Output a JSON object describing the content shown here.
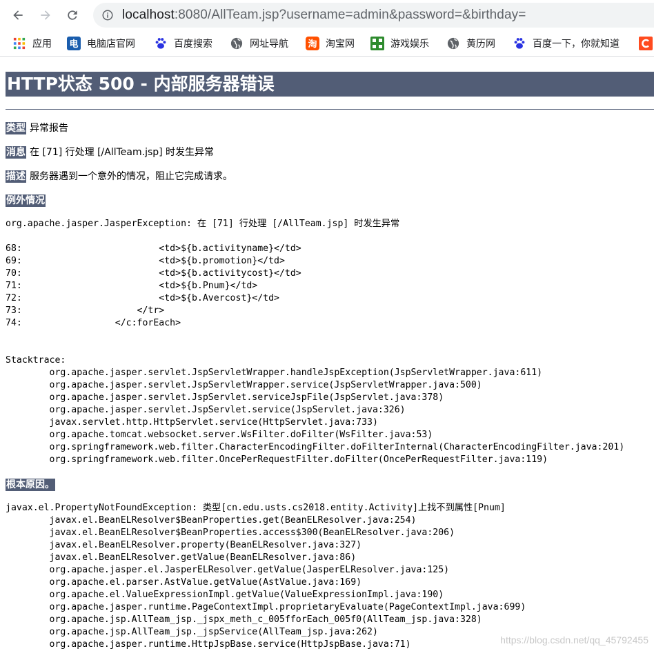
{
  "browser": {
    "url_host": "localhost",
    "url_rest": ":8080/AllTeam.jsp?username=admin&password=&birthday=",
    "bookmarks": [
      {
        "label": "应用",
        "icon": "apps-grid-icon"
      },
      {
        "label": "电脑店官网",
        "icon": "diannaodian-icon"
      },
      {
        "label": "百度搜索",
        "icon": "baidu-paw-icon"
      },
      {
        "label": "网址导航",
        "icon": "globe-icon"
      },
      {
        "label": "淘宝网",
        "icon": "taobao-icon"
      },
      {
        "label": "游戏娱乐",
        "icon": "game-icon"
      },
      {
        "label": "黄历网",
        "icon": "globe-icon"
      },
      {
        "label": "百度一下，你就知道",
        "icon": "baidu-paw-icon"
      }
    ]
  },
  "error": {
    "title": "HTTP状态 500 - 内部服务器错误",
    "type_label": "类型",
    "type_value": "异常报告",
    "message_label": "消息",
    "message_value": "在 [71] 行处理 [/AllTeam.jsp] 时发生异常",
    "description_label": "描述",
    "description_value": "服务器遇到一个意外的情况，阻止它完成请求。",
    "exception_label": "例外情况",
    "exception_lines": [
      "org.apache.jasper.JasperException: 在 [71] 行处理 [/AllTeam.jsp] 时发生异常",
      "",
      "68:                         <td>${b.activityname}</td>",
      "69:                         <td>${b.promotion}</td>",
      "70:                         <td>${b.activitycost}</td>",
      "71:                         <td>${b.Pnum}</td>",
      "72:                         <td>${b.Avercost}</td>",
      "73:                     </tr>",
      "74:                 </c:forEach>",
      "",
      "",
      "Stacktrace:",
      "        org.apache.jasper.servlet.JspServletWrapper.handleJspException(JspServletWrapper.java:611)",
      "        org.apache.jasper.servlet.JspServletWrapper.service(JspServletWrapper.java:500)",
      "        org.apache.jasper.servlet.JspServlet.serviceJspFile(JspServlet.java:378)",
      "        org.apache.jasper.servlet.JspServlet.service(JspServlet.java:326)",
      "        javax.servlet.http.HttpServlet.service(HttpServlet.java:733)",
      "        org.apache.tomcat.websocket.server.WsFilter.doFilter(WsFilter.java:53)",
      "        org.springframework.web.filter.CharacterEncodingFilter.doFilterInternal(CharacterEncodingFilter.java:201)",
      "        org.springframework.web.filter.OncePerRequestFilter.doFilter(OncePerRequestFilter.java:119)"
    ],
    "root_cause_label": "根本原因。",
    "root_cause_lines": [
      "javax.el.PropertyNotFoundException: 类型[cn.edu.usts.cs2018.entity.Activity]上找不到属性[Pnum]",
      "        javax.el.BeanELResolver$BeanProperties.get(BeanELResolver.java:254)",
      "        javax.el.BeanELResolver$BeanProperties.access$300(BeanELResolver.java:206)",
      "        javax.el.BeanELResolver.property(BeanELResolver.java:327)",
      "        javax.el.BeanELResolver.getValue(BeanELResolver.java:86)",
      "        org.apache.jasper.el.JasperELResolver.getValue(JasperELResolver.java:125)",
      "        org.apache.el.parser.AstValue.getValue(AstValue.java:169)",
      "        org.apache.el.ValueExpressionImpl.getValue(ValueExpressionImpl.java:190)",
      "        org.apache.jasper.runtime.PageContextImpl.proprietaryEvaluate(PageContextImpl.java:699)",
      "        org.apache.jsp.AllTeam_jsp._jspx_meth_c_005fforEach_005f0(AllTeam_jsp.java:328)",
      "        org.apache.jsp.AllTeam_jsp._jspService(AllTeam_jsp.java:262)",
      "        org.apache.jasper.runtime.HttpJspBase.service(HttpJspBase.java:71)"
    ]
  },
  "watermark": "https://blog.csdn.net/qq_45792455",
  "colors": {
    "heading_bg": "#525d76",
    "heading_text": "#ffffff"
  }
}
